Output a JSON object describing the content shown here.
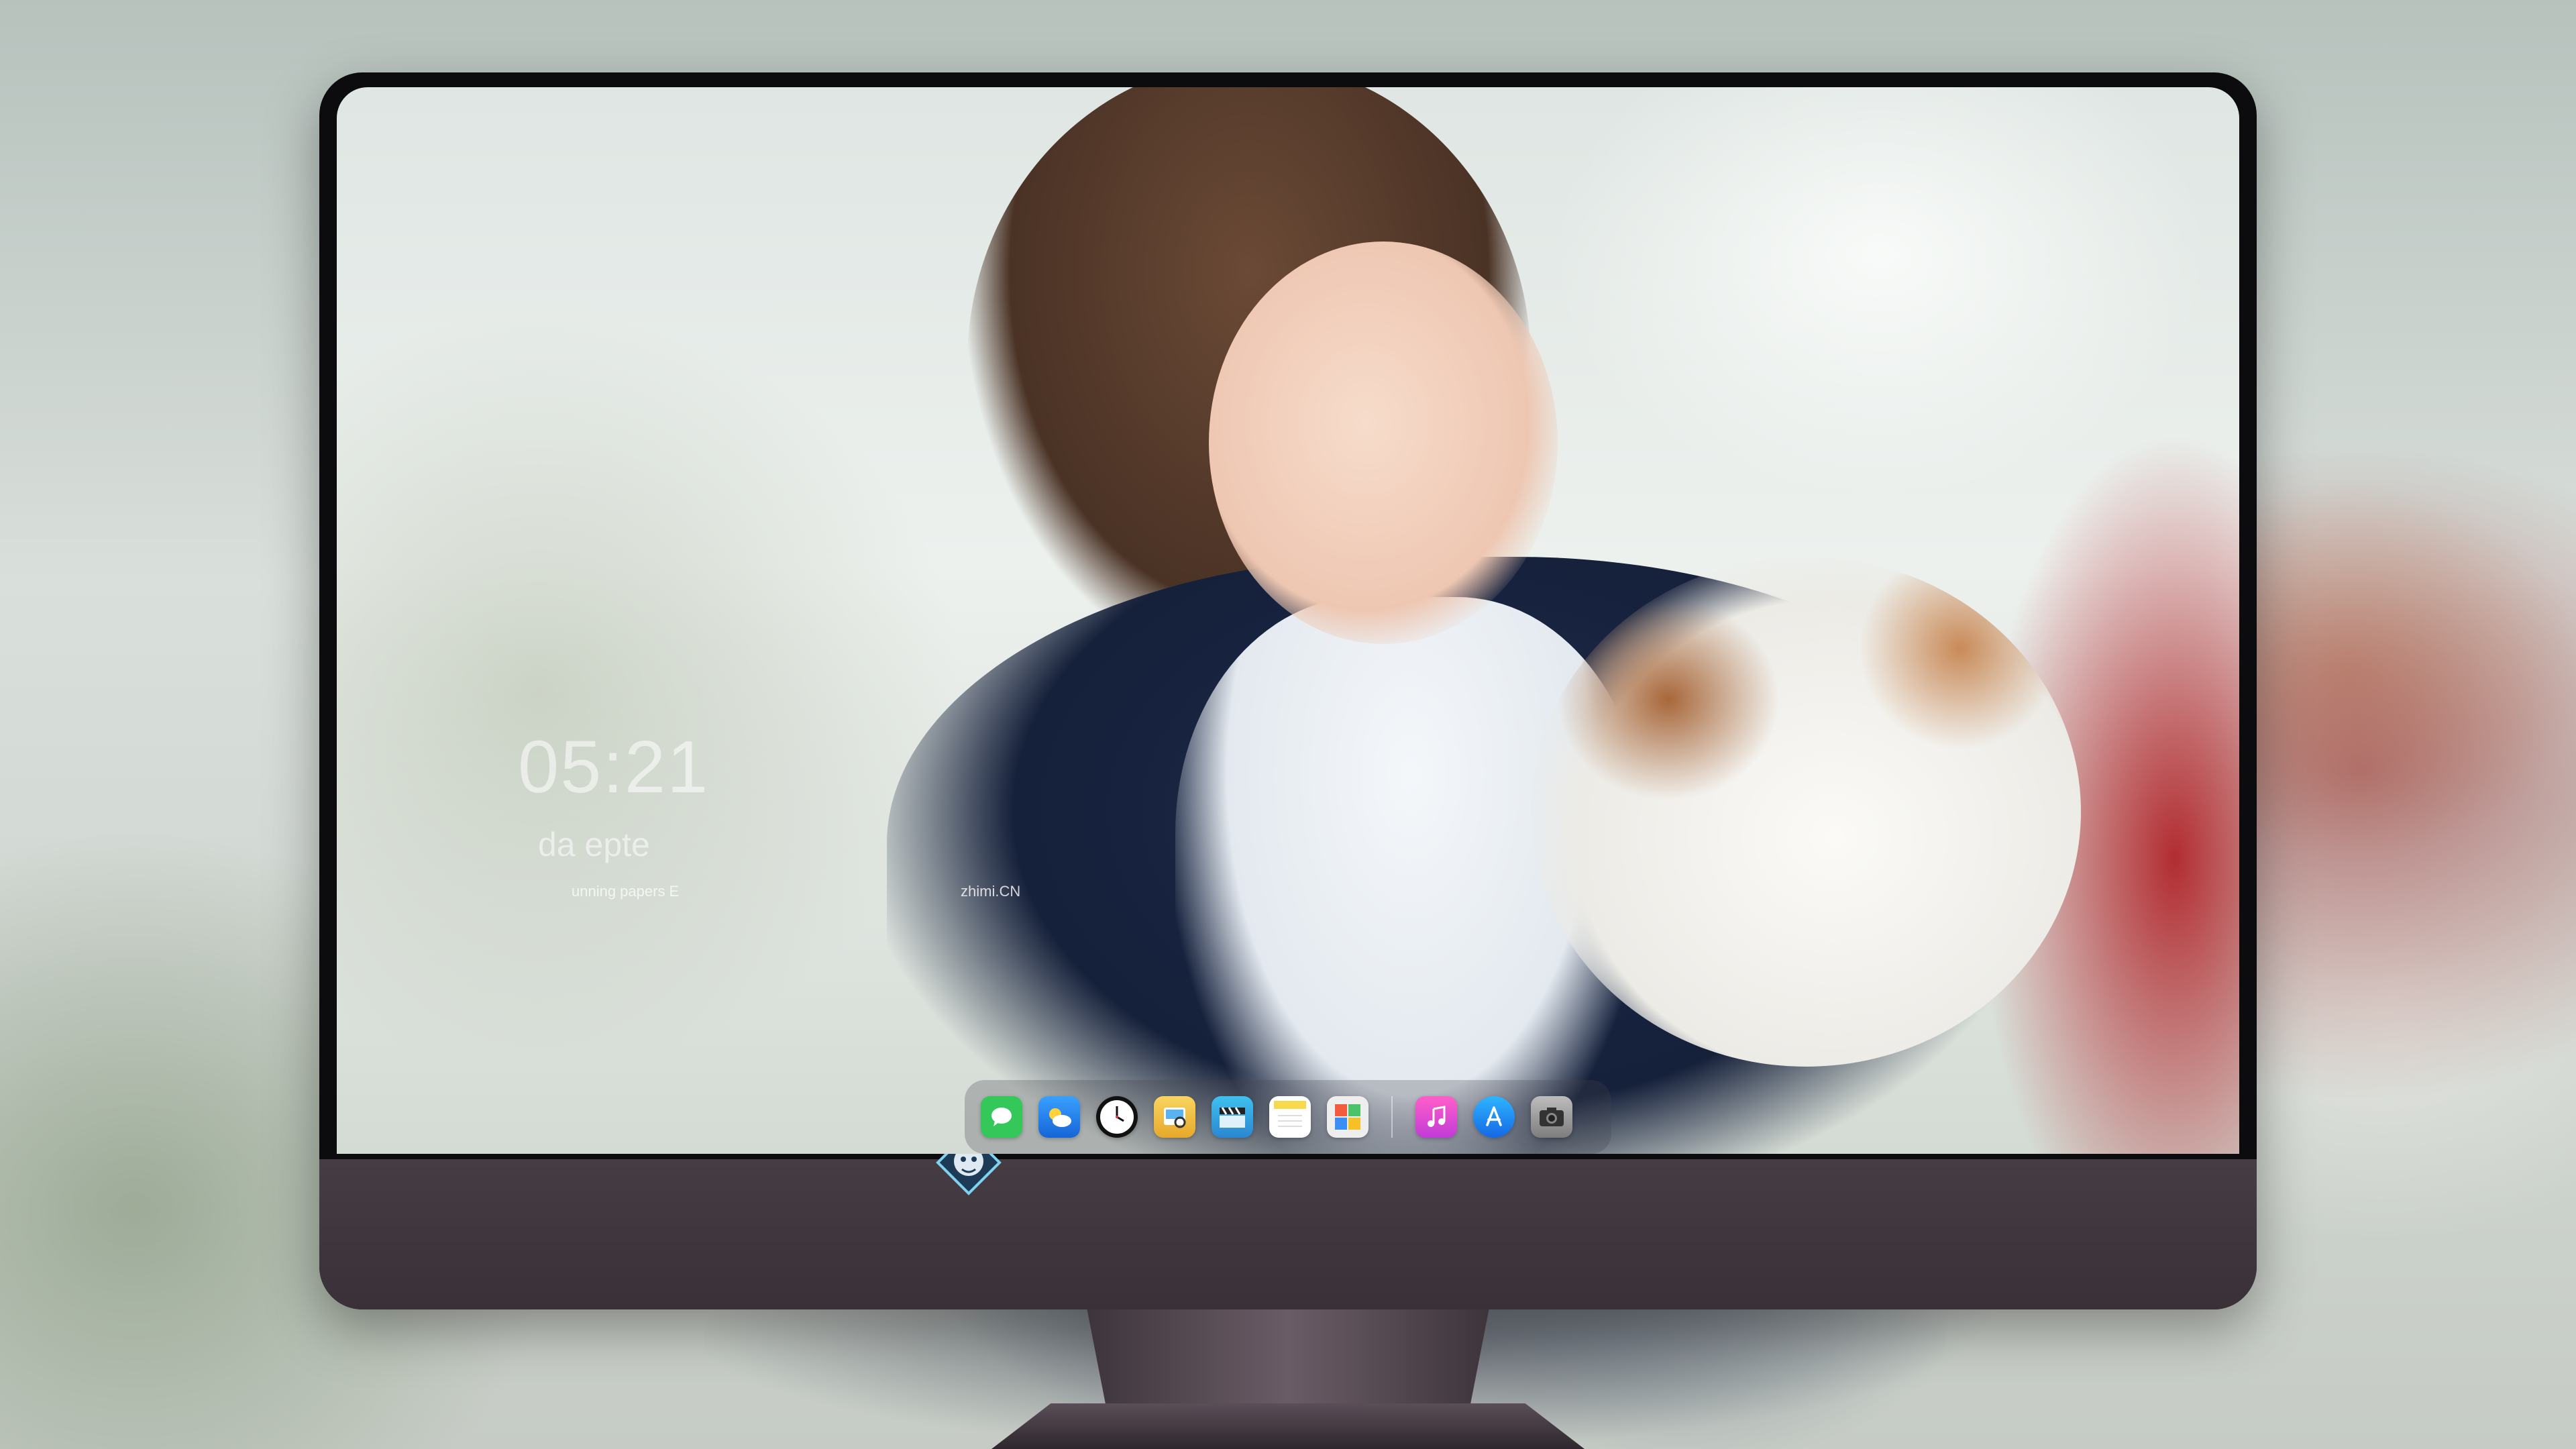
{
  "desktop": {
    "clock_time": "05:21",
    "date_text": "da   epte",
    "credit_text": "unning   papers  E",
    "credit_site": "zhimi.CN"
  },
  "dock": {
    "apps": [
      {
        "name": "messages-icon",
        "color": "#34c759"
      },
      {
        "name": "weather-icon",
        "color": "#1e90ff"
      },
      {
        "name": "clock-icon",
        "color": "#ffffff"
      },
      {
        "name": "preview-icon",
        "color": "#f4c542"
      },
      {
        "name": "video-editor-icon",
        "color": "#3fb7e8"
      },
      {
        "name": "notes-icon",
        "color": "#f7d94c"
      },
      {
        "name": "photos-app-icon",
        "color": "#e9e9e9"
      },
      {
        "name": "music-icon",
        "color": "#e84ab5"
      },
      {
        "name": "app-store-icon",
        "color": "#1a8cff"
      },
      {
        "name": "camera-icon",
        "color": "#9a9a9a"
      }
    ]
  },
  "monitor": {
    "bezel_color": "#0c0c0e",
    "chin_color": "#3a3138",
    "logo": "mascot-logo-icon"
  }
}
